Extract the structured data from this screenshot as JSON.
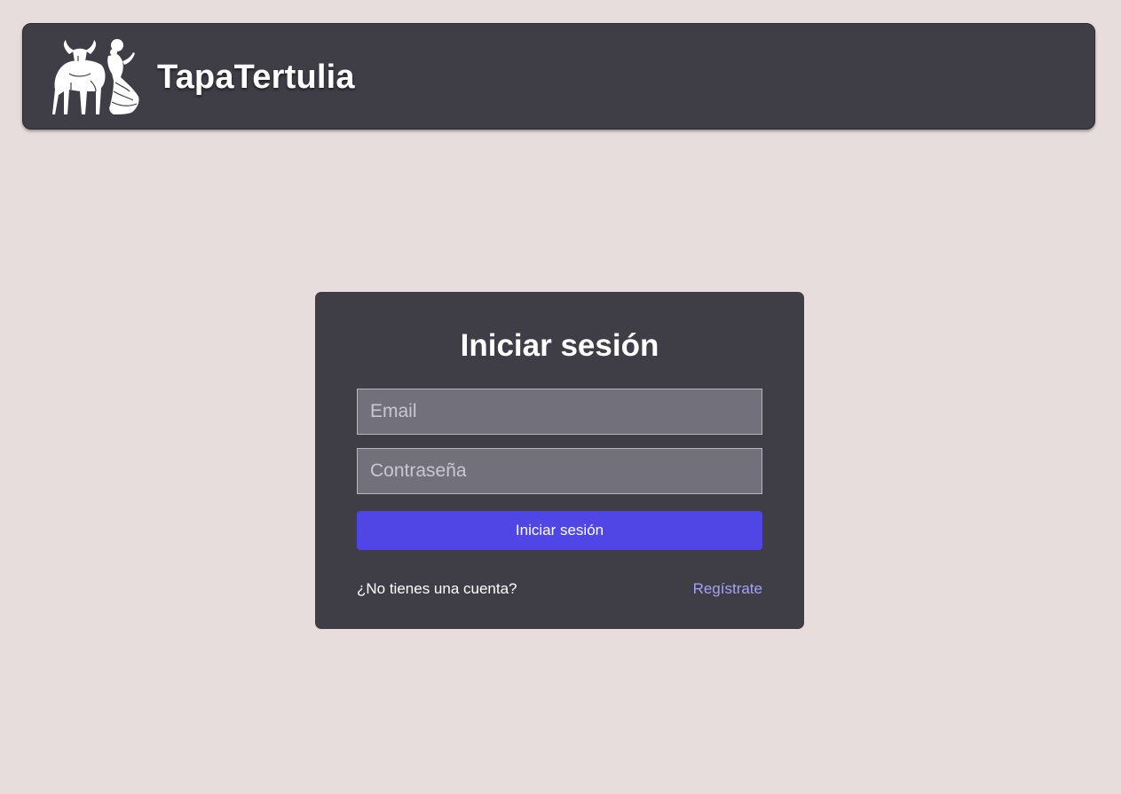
{
  "header": {
    "brand": "TapaTertulia",
    "logo_icon": "bull-and-flamenco-dancer-logo"
  },
  "login": {
    "title": "Iniciar sesión",
    "email": {
      "placeholder": "Email",
      "value": ""
    },
    "password": {
      "placeholder": "Contraseña",
      "value": ""
    },
    "submit_label": "Iniciar sesión",
    "no_account_text": "¿No tienes una cuenta?",
    "register_label": "Regístrate"
  },
  "colors": {
    "page_background": "#e7dddc",
    "panel_background": "#3f3e47",
    "input_background": "#72717b",
    "primary_button": "#4f46e5",
    "link": "#a5a1f5"
  }
}
